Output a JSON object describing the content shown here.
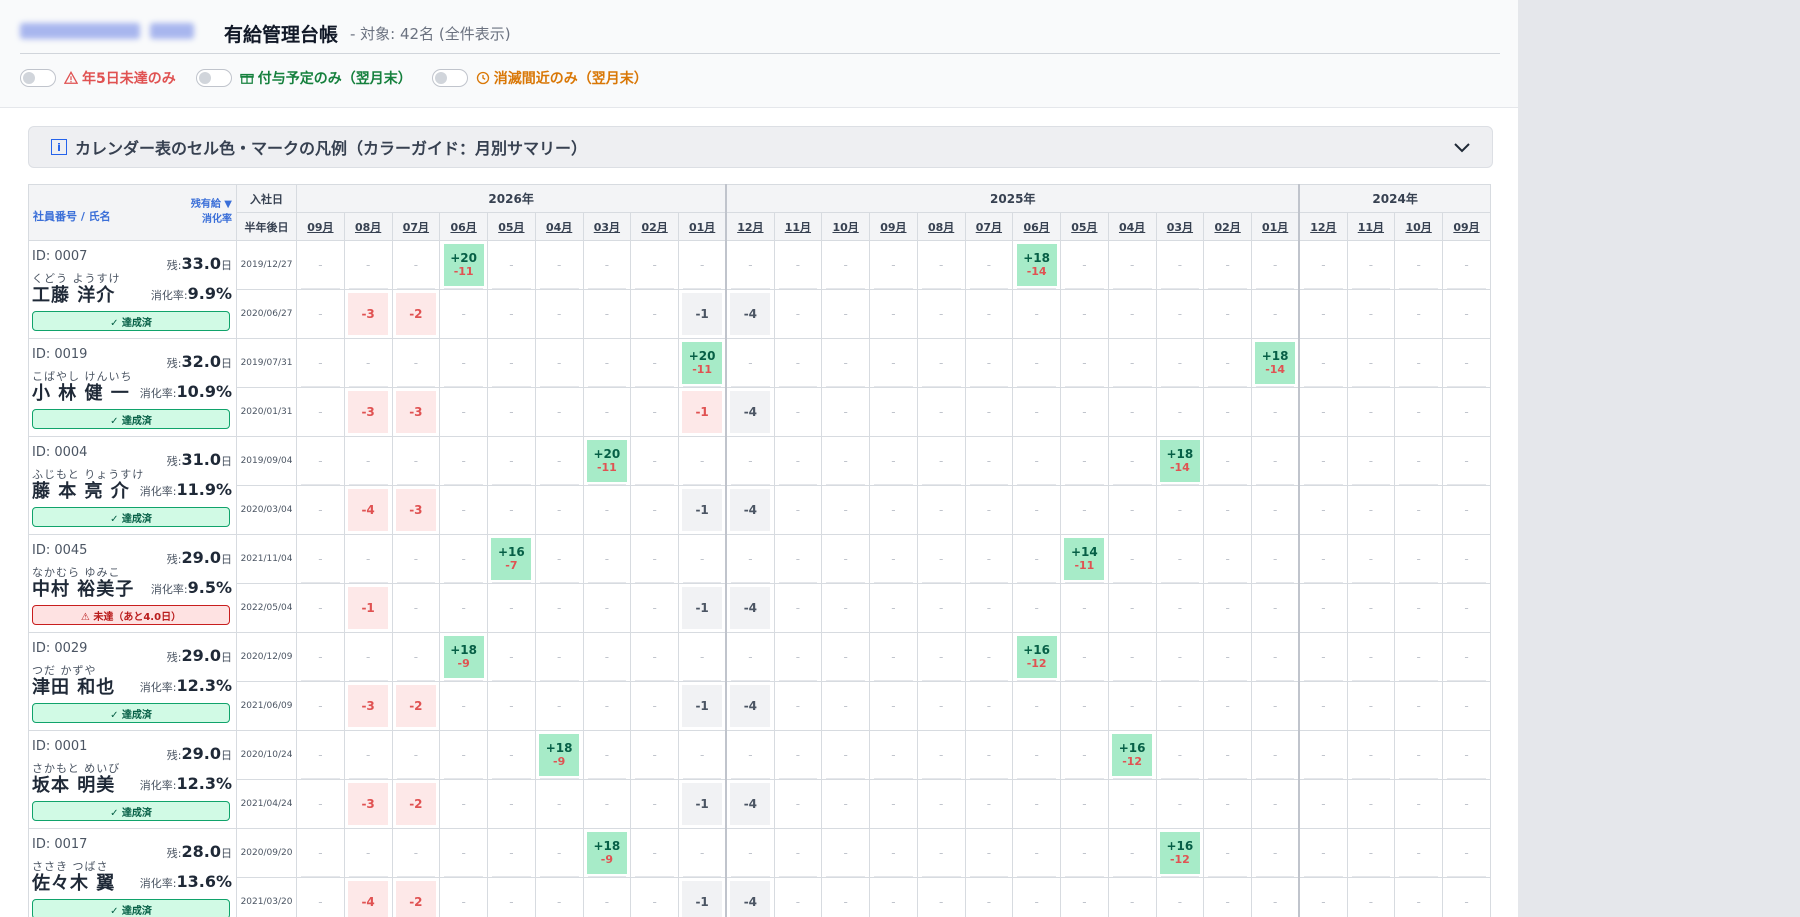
{
  "header": {
    "title": "有給管理台帳",
    "subtitle": "- 対象: 42名 (全件表示)"
  },
  "filters": [
    {
      "label": "年5日未達のみ",
      "icon": "warning-icon",
      "color": "#e05252"
    },
    {
      "label": "付与予定のみ（翌月末）",
      "icon": "gift-icon",
      "color": "#15803d"
    },
    {
      "label": "消滅間近のみ（翌月末）",
      "icon": "clock-icon",
      "color": "#d97706"
    }
  ],
  "legend": {
    "label": "カレンダー表のセル色・マークの凡例（カラーガイド：月別サマリー）"
  },
  "grid": {
    "emp_header_left": "社員番号 /  氏名",
    "emp_header_right_1": "残有給 ▼",
    "emp_header_right_2": "消化率",
    "date_header_1": "入社日",
    "date_header_2": "半年後日",
    "years": [
      {
        "label": "2026年",
        "span": 9
      },
      {
        "label": "2025年",
        "span": 12
      },
      {
        "label": "2024年",
        "span": 4
      }
    ],
    "months": [
      "09月",
      "08月",
      "07月",
      "06月",
      "05月",
      "04月",
      "03月",
      "02月",
      "01月",
      "12月",
      "11月",
      "10月",
      "09月",
      "08月",
      "07月",
      "06月",
      "05月",
      "04月",
      "03月",
      "02月",
      "01月",
      "12月",
      "11月",
      "10月",
      "09月"
    ]
  },
  "remain_label": "残:",
  "remain_unit": "日",
  "rate_label": "消化率:",
  "employees": [
    {
      "id": "ID: 0007",
      "kana": "くどう ようすけ",
      "name": "工藤 洋介",
      "remain": "33.0",
      "rate": "9.9%",
      "status": "✓ 達成済",
      "ok": true,
      "hire": "2019/12/27",
      "half": "2020/06/27",
      "grant": {
        "3": [
          "+20",
          "-11"
        ],
        "15": [
          "+18",
          "-14"
        ]
      },
      "use": {
        "1": "-3",
        "2": "-2",
        "8": "-1",
        "9": "-4"
      }
    },
    {
      "id": "ID: 0019",
      "kana": "こばやし けんいち",
      "name": "小 林  健 一",
      "remain": "32.0",
      "rate": "10.9%",
      "status": "✓ 達成済",
      "ok": true,
      "hire": "2019/07/31",
      "half": "2020/01/31",
      "grant": {
        "8": [
          "+20",
          "-11"
        ],
        "20": [
          "+18",
          "-14"
        ]
      },
      "use": {
        "1": "-3",
        "2": "-3",
        "8": "-1",
        "9": "-4"
      }
    },
    {
      "id": "ID: 0004",
      "kana": "ふじもと りょうすけ",
      "name": "藤 本  亮 介",
      "remain": "31.0",
      "rate": "11.9%",
      "status": "✓ 達成済",
      "ok": true,
      "hire": "2019/09/04",
      "half": "2020/03/04",
      "grant": {
        "6": [
          "+20",
          "-11"
        ],
        "18": [
          "+18",
          "-14"
        ]
      },
      "use": {
        "1": "-4",
        "2": "-3",
        "8": "-1",
        "9": "-4"
      }
    },
    {
      "id": "ID: 0045",
      "kana": "なかむら ゆみこ",
      "name": "中村 裕美子",
      "remain": "29.0",
      "rate": "9.5%",
      "status": "⚠ 未達（あと4.0日）",
      "ok": false,
      "hire": "2021/11/04",
      "half": "2022/05/04",
      "grant": {
        "4": [
          "+16",
          "-7"
        ],
        "16": [
          "+14",
          "-11"
        ]
      },
      "use": {
        "1": "-1",
        "8": "-1",
        "9": "-4"
      }
    },
    {
      "id": "ID: 0029",
      "kana": "つだ  かずや",
      "name": "津田 和也",
      "remain": "29.0",
      "rate": "12.3%",
      "status": "✓ 達成済",
      "ok": true,
      "hire": "2020/12/09",
      "half": "2021/06/09",
      "grant": {
        "3": [
          "+18",
          "-9"
        ],
        "15": [
          "+16",
          "-12"
        ]
      },
      "use": {
        "1": "-3",
        "2": "-2",
        "8": "-1",
        "9": "-4"
      }
    },
    {
      "id": "ID: 0001",
      "kana": "さかもと めいび",
      "name": "坂本 明美",
      "remain": "29.0",
      "rate": "12.3%",
      "status": "✓ 達成済",
      "ok": true,
      "hire": "2020/10/24",
      "half": "2021/04/24",
      "grant": {
        "5": [
          "+18",
          "-9"
        ],
        "17": [
          "+16",
          "-12"
        ]
      },
      "use": {
        "1": "-3",
        "2": "-2",
        "8": "-1",
        "9": "-4"
      }
    },
    {
      "id": "ID: 0017",
      "kana": "ささき つばさ",
      "name": "佐々木 翼",
      "remain": "28.0",
      "rate": "13.6%",
      "status": "✓ 達成済",
      "ok": true,
      "hire": "2020/09/20",
      "half": "2021/03/20",
      "grant": {
        "6": [
          "+18",
          "-9"
        ],
        "18": [
          "+16",
          "-12"
        ]
      },
      "use": {
        "1": "-4",
        "2": "-2",
        "8": "-1",
        "9": "-4"
      }
    }
  ],
  "empty_mark": "-"
}
